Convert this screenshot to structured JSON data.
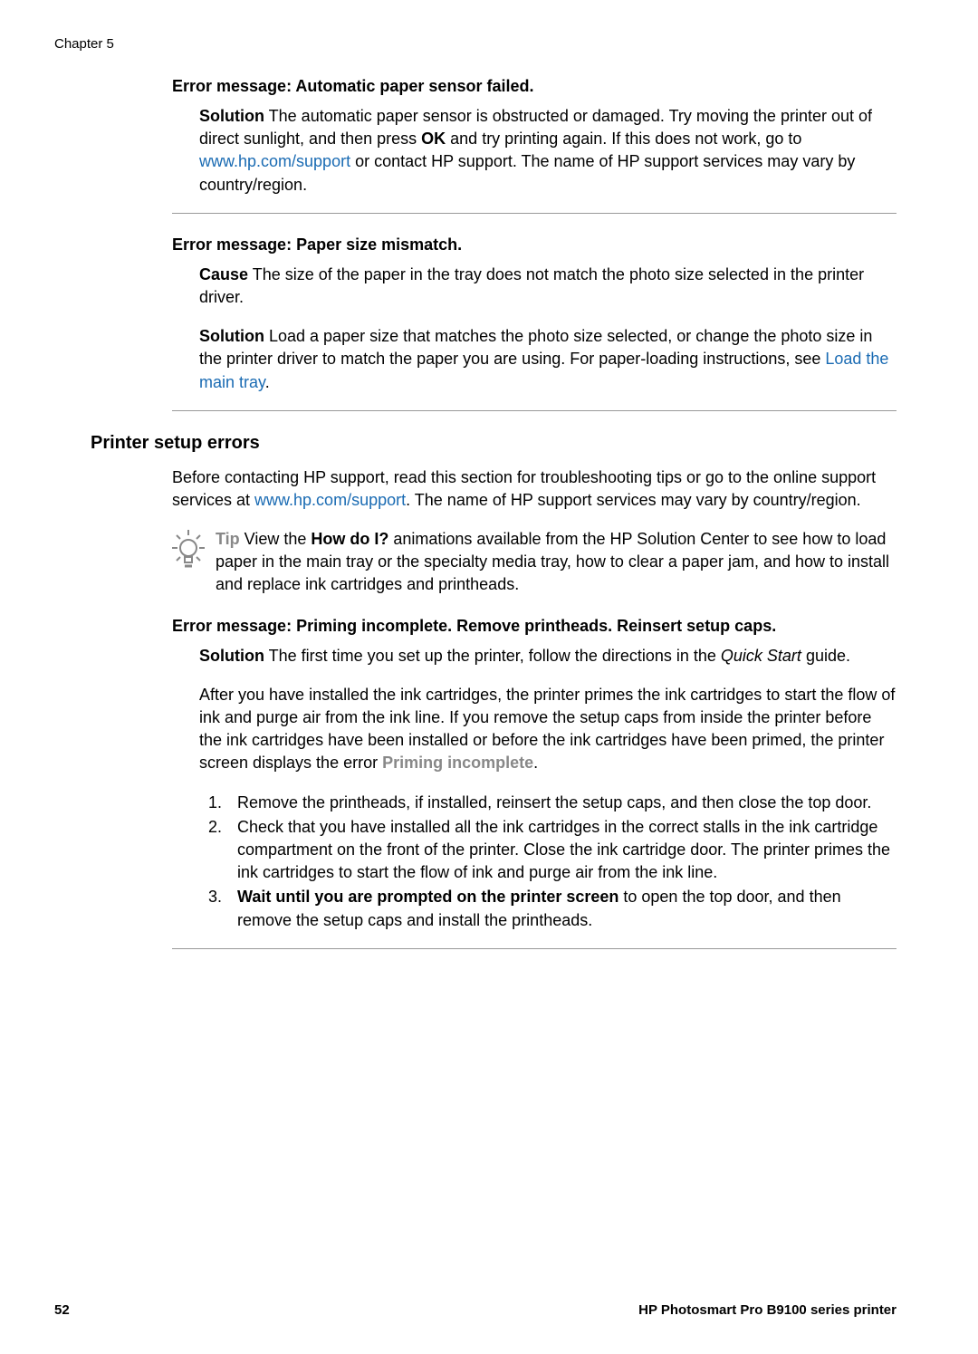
{
  "chapter": "Chapter 5",
  "error1": {
    "heading": "Error message: Automatic paper sensor failed.",
    "solution_label": "Solution",
    "solution_text1": "   The automatic paper sensor is obstructed or damaged. Try moving the printer out of direct sunlight, and then press ",
    "ok": "OK",
    "solution_text2": " and try printing again. If this does not work, go to ",
    "link": "www.hp.com/support",
    "solution_text3": " or contact HP support. The name of HP support services may vary by country/region."
  },
  "error2": {
    "heading": "Error message: Paper size mismatch.",
    "cause_label": "Cause",
    "cause_text": "   The size of the paper in the tray does not match the photo size selected in the printer driver.",
    "solution_label": "Solution",
    "solution_text1": "   Load a paper size that matches the photo size selected, or change the photo size in the printer driver to match the paper you are using. For paper-loading instructions, see ",
    "link": "Load the main tray",
    "period": "."
  },
  "section": {
    "heading": "Printer setup errors",
    "body1": "Before contacting HP support, read this section for troubleshooting tips or go to the online support services at ",
    "link": "www.hp.com/support",
    "body2": ". The name of HP support services may vary by country/region."
  },
  "tip": {
    "label": "Tip",
    "text1": "   View the ",
    "howdoi": "How do I?",
    "text2": " animations available from the HP Solution Center to see how to load paper in the main tray or the specialty media tray, how to clear a paper jam, and how to install and replace ink cartridges and printheads."
  },
  "error3": {
    "heading": "Error message: Priming incomplete. Remove printheads. Reinsert setup caps.",
    "solution_label": "Solution",
    "solution_text1": "   The first time you set up the printer, follow the directions in the ",
    "quickstart": "Quick Start",
    "solution_text2": " guide.",
    "para2a": "After you have installed the ink cartridges, the printer primes the ink cartridges to start the flow of ink and purge air from the ink line. If you remove the setup caps from inside the printer before the ink cartridges have been installed or before the ink cartridges have been primed, the printer screen displays the error ",
    "priming": "Priming incomplete",
    "para2b": ".",
    "step1": "Remove the printheads, if installed, reinsert the setup caps, and then close the top door.",
    "step2": "Check that you have installed all the ink cartridges in the correct stalls in the ink cartridge compartment on the front of the printer. Close the ink cartridge door. The printer primes the ink cartridges to start the flow of ink and purge air from the ink line.",
    "step3a": "Wait until you are prompted on the printer screen",
    "step3b": " to open the top door, and then remove the setup caps and install the printheads."
  },
  "footer": {
    "page": "52",
    "title": "HP Photosmart Pro B9100 series printer"
  }
}
